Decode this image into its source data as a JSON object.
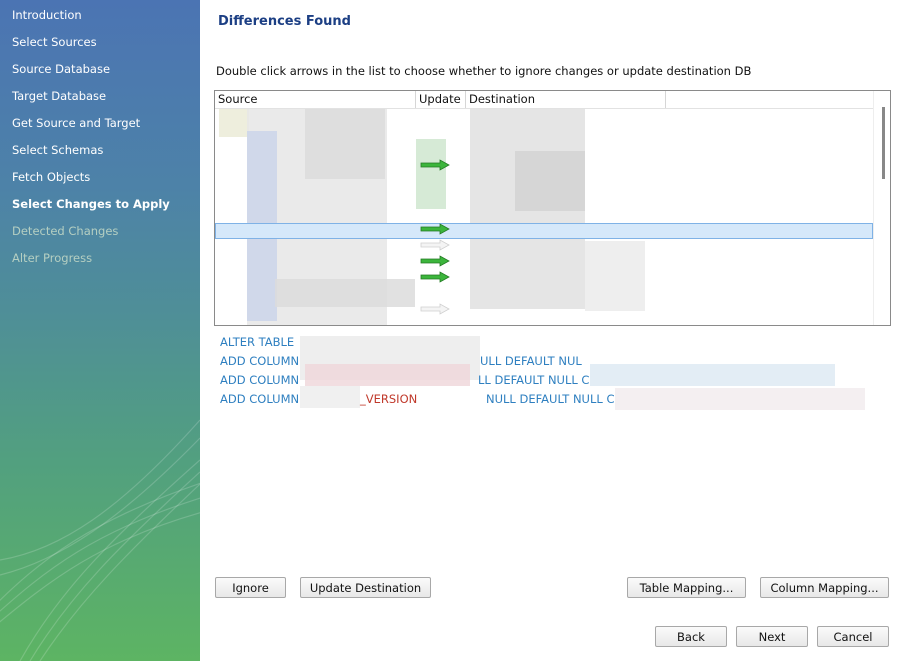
{
  "sidebar": {
    "items": [
      {
        "label": "Introduction",
        "state": "done"
      },
      {
        "label": "Select Sources",
        "state": "done"
      },
      {
        "label": "Source Database",
        "state": "done"
      },
      {
        "label": "Target Database",
        "state": "done"
      },
      {
        "label": "Get Source and Target",
        "state": "done"
      },
      {
        "label": "Select Schemas",
        "state": "done"
      },
      {
        "label": "Fetch Objects",
        "state": "done"
      },
      {
        "label": "Select Changes to Apply",
        "state": "active"
      },
      {
        "label": "Detected Changes",
        "state": "disabled"
      },
      {
        "label": "Alter Progress",
        "state": "disabled"
      }
    ]
  },
  "main": {
    "title": "Differences Found",
    "instruction": "Double click arrows in the list to choose whether to ignore changes or update destination DB",
    "columns": [
      "Source",
      "Update",
      "Destination"
    ],
    "sql_lines": [
      {
        "prefix": "ALTER TABLE",
        "middle": "",
        "suffix": ""
      },
      {
        "prefix": "ADD COLUMN",
        "middle": "",
        "suffix": "ULL DEFAULT NUL"
      },
      {
        "prefix": "ADD COLUMN",
        "middle": "",
        "suffix": "LL DEFAULT NULL C"
      },
      {
        "prefix": "ADD COLUMN",
        "middle": "_VERSION",
        "suffix": "NULL DEFAULT NULL C"
      }
    ]
  },
  "buttons": {
    "ignore": "Ignore",
    "update_destination": "Update Destination",
    "table_mapping": "Table Mapping...",
    "column_mapping": "Column Mapping...",
    "back": "Back",
    "next": "Next",
    "cancel": "Cancel"
  },
  "colors": {
    "title": "#1c3f84",
    "sql_text": "#2e7fc0",
    "arrow_green": "#3cb53c",
    "selection": "#d5e8fa"
  }
}
